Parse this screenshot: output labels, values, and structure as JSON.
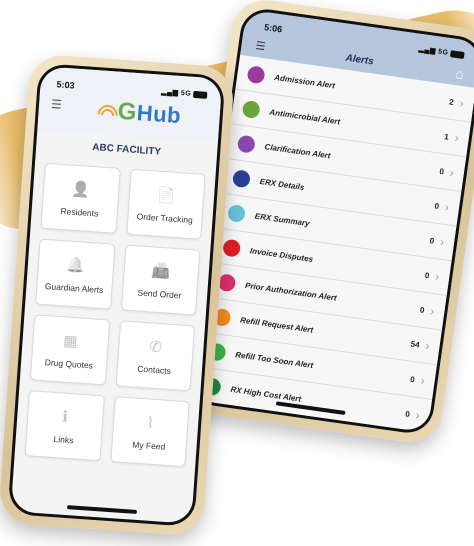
{
  "left_phone": {
    "time": "5:03",
    "signal": "5G",
    "logo": {
      "prefix": "G",
      "suffix": "Hub"
    },
    "facility": "ABC FACILITY",
    "tiles": [
      {
        "label": "Residents",
        "icon": "person-icon"
      },
      {
        "label": "Order Tracking",
        "icon": "document-icon"
      },
      {
        "label": "Guardian Alerts",
        "icon": "bell-icon"
      },
      {
        "label": "Send Order",
        "icon": "fax-icon"
      },
      {
        "label": "Drug Quotes",
        "icon": "calculator-icon"
      },
      {
        "label": "Contacts",
        "icon": "phone-icon"
      },
      {
        "label": "Links",
        "icon": "info-icon"
      },
      {
        "label": "My Feed",
        "icon": "rss-icon"
      }
    ]
  },
  "right_phone": {
    "time": "5:06",
    "signal": "5G",
    "title": "Alerts",
    "alerts": [
      {
        "name": "Admission Alert",
        "count": "2",
        "color": "#9b3a9a"
      },
      {
        "name": "Antimicrobial Alert",
        "count": "1",
        "color": "#6aa535"
      },
      {
        "name": "Clarification Alert",
        "count": "0",
        "color": "#8a48b3"
      },
      {
        "name": "ERX Details",
        "count": "0",
        "color": "#2a3f97"
      },
      {
        "name": "ERX Summary",
        "count": "0",
        "color": "#67c3d8"
      },
      {
        "name": "Invoice Disputes",
        "count": "0",
        "color": "#de1f26"
      },
      {
        "name": "Prior Authorization Alert",
        "count": "0",
        "color": "#d93169"
      },
      {
        "name": "Refill Request Alert",
        "count": "54",
        "color": "#f28b22"
      },
      {
        "name": "Refill Too Soon Alert",
        "count": "0",
        "color": "#3bb34a"
      },
      {
        "name": "RX High Cost Alert",
        "count": "0",
        "color": "#1d8a3c"
      }
    ]
  }
}
